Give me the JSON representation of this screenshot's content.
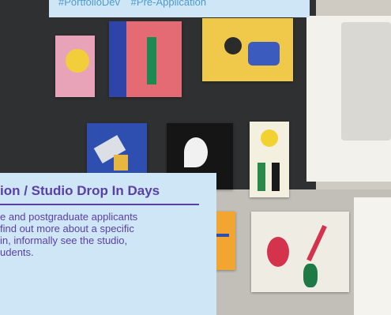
{
  "tags": [
    "#PortfolioDev",
    "#Pre-Application"
  ],
  "card": {
    "title": "ion / Studio Drop In Days",
    "body_lines": [
      "e and postgraduate applicants",
      "find out more about a specific",
      " in, informally see the studio,",
      "udents."
    ]
  },
  "colors": {
    "panel_bg": "#cfe6f6",
    "title": "#5a3fa8",
    "tag_text": "#4d9bd0"
  }
}
